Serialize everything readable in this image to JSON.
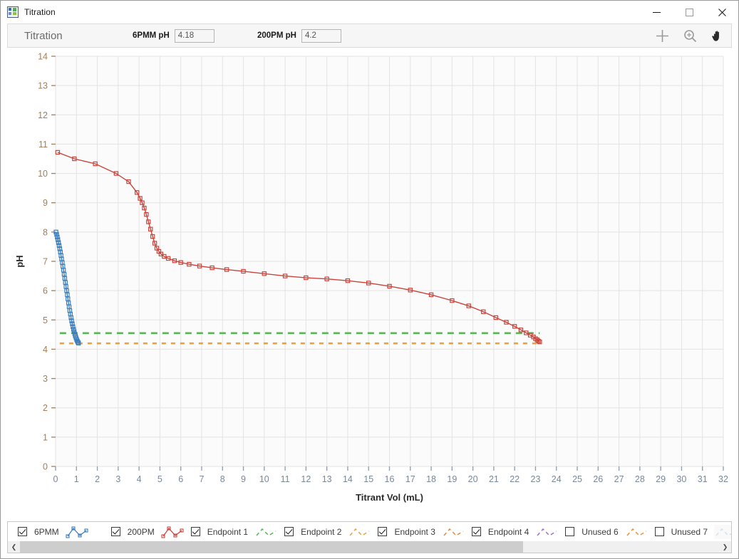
{
  "window": {
    "title": "Titration",
    "icon": "app-chart-icon",
    "controls": {
      "minimize": "minimize-icon",
      "maximize": "maximize-icon",
      "close": "close-icon"
    }
  },
  "toolbar": {
    "title": "Titration",
    "fields": [
      {
        "label": "6PMM pH",
        "value": "4.18",
        "placeholder": ""
      },
      {
        "label": "200PM pH",
        "value": "4.2",
        "placeholder": ""
      }
    ],
    "icons": [
      {
        "name": "crosshair-icon",
        "active": false
      },
      {
        "name": "zoom-in-icon",
        "active": false
      },
      {
        "name": "pan-hand-icon",
        "active": true
      }
    ]
  },
  "legend": {
    "items": [
      {
        "label": "6PMM",
        "checked": true,
        "color": "#3b7fbf",
        "style": "line-marker",
        "enabled": true
      },
      {
        "label": "200PM",
        "checked": true,
        "color": "#c9453c",
        "style": "line-marker",
        "enabled": true
      },
      {
        "label": "Endpoint 1",
        "checked": true,
        "color": "#59b558",
        "style": "dashed",
        "enabled": true
      },
      {
        "label": "Endpoint 2",
        "checked": true,
        "color": "#e8a33d",
        "style": "dashed",
        "enabled": true
      },
      {
        "label": "Endpoint 3",
        "checked": true,
        "color": "#e8873d",
        "style": "dashed",
        "enabled": true
      },
      {
        "label": "Endpoint 4",
        "checked": true,
        "color": "#9b72c4",
        "style": "dashed",
        "enabled": true
      },
      {
        "label": "Unused 6",
        "checked": false,
        "color": "#e8913d",
        "style": "dashed",
        "enabled": true
      },
      {
        "label": "Unused 7",
        "checked": false,
        "color": "#7fb9d8",
        "style": "dashed",
        "enabled": false
      },
      {
        "label": "Unused 7",
        "checked": false,
        "color": "#c9a3d8",
        "style": "dashed",
        "enabled": false
      }
    ]
  },
  "scrollbar": {
    "left_arrow": "chevron-left-icon",
    "right_arrow": "chevron-right-icon",
    "thumb_percent": 72
  },
  "chart_data": {
    "type": "line",
    "title": "",
    "xlabel": "Titrant Vol (mL)",
    "ylabel": "pH",
    "xlim": [
      0,
      32
    ],
    "ylim": [
      0,
      14
    ],
    "xticks": [
      0,
      1,
      2,
      3,
      4,
      5,
      6,
      7,
      8,
      9,
      10,
      11,
      12,
      13,
      14,
      15,
      16,
      17,
      18,
      19,
      20,
      21,
      22,
      23,
      24,
      25,
      26,
      27,
      28,
      29,
      30,
      31,
      32
    ],
    "yticks": [
      0,
      1,
      2,
      3,
      4,
      5,
      6,
      7,
      8,
      9,
      10,
      11,
      12,
      13,
      14
    ],
    "grid": true,
    "legend_position": "bottom",
    "markers": "open-square",
    "series": [
      {
        "name": "6PMM",
        "color": "#3b7fbf",
        "x": [
          0.02,
          0.05,
          0.08,
          0.11,
          0.14,
          0.17,
          0.2,
          0.23,
          0.26,
          0.29,
          0.32,
          0.35,
          0.38,
          0.41,
          0.44,
          0.47,
          0.5,
          0.53,
          0.56,
          0.59,
          0.62,
          0.65,
          0.68,
          0.71,
          0.74,
          0.77,
          0.8,
          0.83,
          0.86,
          0.89,
          0.92,
          0.95,
          0.98,
          1.01,
          1.04,
          1.07,
          1.1
        ],
        "y": [
          8.0,
          7.92,
          7.83,
          7.74,
          7.64,
          7.54,
          7.43,
          7.32,
          7.2,
          7.08,
          6.96,
          6.83,
          6.7,
          6.56,
          6.42,
          6.28,
          6.14,
          6.0,
          5.86,
          5.72,
          5.58,
          5.45,
          5.32,
          5.2,
          5.08,
          4.97,
          4.87,
          4.77,
          4.68,
          4.6,
          4.52,
          4.45,
          4.39,
          4.33,
          4.28,
          4.24,
          4.21
        ]
      },
      {
        "name": "200PM",
        "color": "#c9453c",
        "x": [
          0.1,
          0.9,
          1.9,
          2.9,
          3.5,
          3.9,
          4.05,
          4.15,
          4.25,
          4.35,
          4.45,
          4.55,
          4.65,
          4.75,
          4.85,
          4.95,
          5.05,
          5.2,
          5.4,
          5.7,
          6.0,
          6.4,
          6.9,
          7.5,
          8.2,
          9.0,
          10.0,
          11.0,
          12.0,
          13.0,
          14.0,
          15.0,
          16.0,
          17.0,
          18.0,
          19.0,
          19.8,
          20.5,
          21.1,
          21.6,
          22.0,
          22.3,
          22.55,
          22.75,
          22.9,
          23.0,
          23.08,
          23.14,
          23.2
        ],
        "y": [
          10.72,
          10.5,
          10.33,
          10.0,
          9.72,
          9.35,
          9.15,
          9.0,
          8.82,
          8.6,
          8.35,
          8.1,
          7.85,
          7.62,
          7.45,
          7.34,
          7.25,
          7.17,
          7.1,
          7.02,
          6.96,
          6.9,
          6.84,
          6.78,
          6.72,
          6.66,
          6.58,
          6.5,
          6.44,
          6.4,
          6.34,
          6.26,
          6.15,
          6.02,
          5.86,
          5.66,
          5.48,
          5.28,
          5.08,
          4.92,
          4.78,
          4.66,
          4.56,
          4.48,
          4.42,
          4.36,
          4.32,
          4.28,
          4.25
        ]
      }
    ],
    "hlines": [
      {
        "name": "Endpoint 1",
        "y": 4.55,
        "color": "#59b558",
        "style": "dashed",
        "x_start": 0.2,
        "x_end": 23.2
      },
      {
        "name": "Endpoint 2",
        "y": 4.2,
        "color": "#e8a33d",
        "style": "dashed",
        "x_start": 0.2,
        "x_end": 23.2
      }
    ]
  }
}
